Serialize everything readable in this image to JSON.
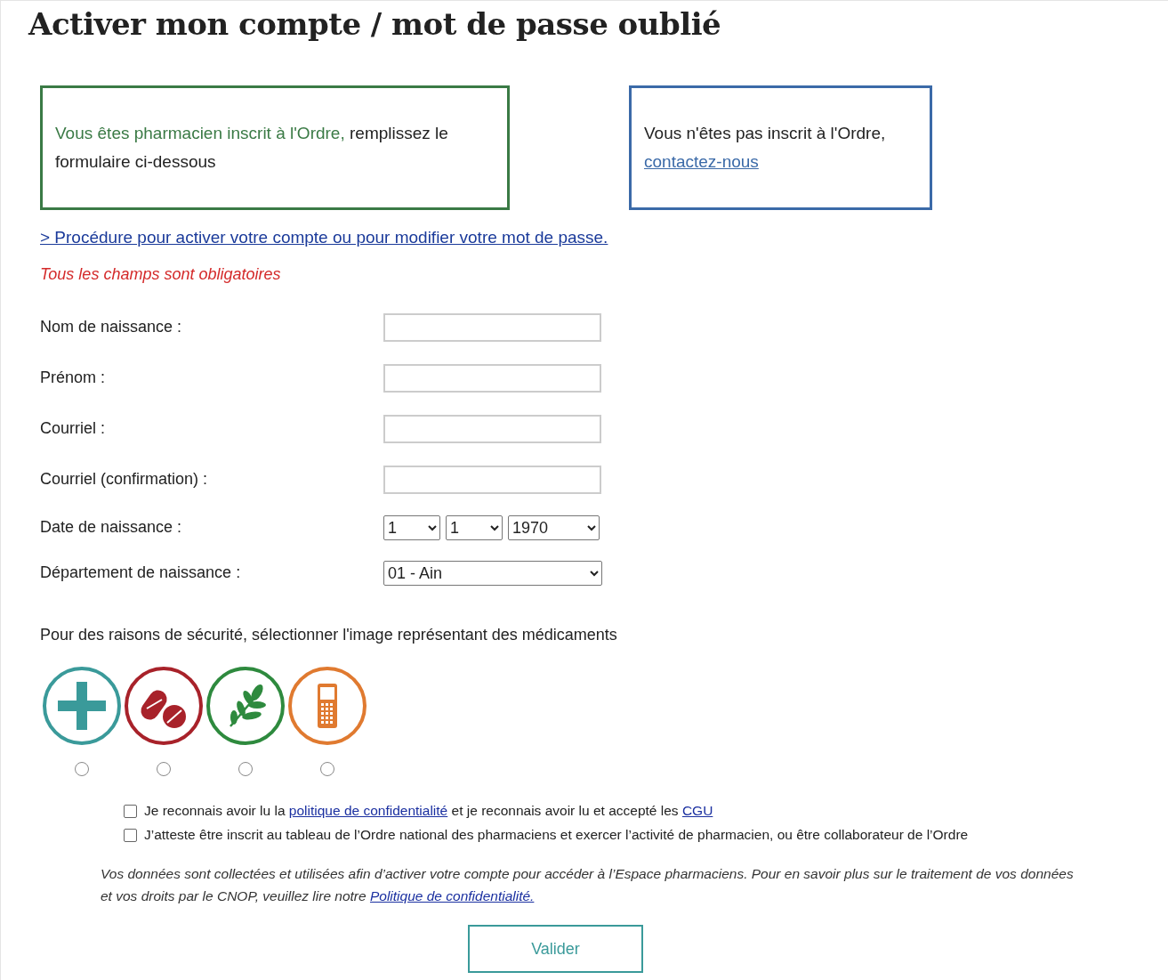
{
  "title": "Activer mon compte / mot de passe oublié",
  "info_boxes": [
    {
      "kind": "member",
      "highlight": "Vous êtes pharmacien inscrit à l'Ordre,",
      "text": " remplissez le formulaire ci-dessous",
      "color": "#3a7a45"
    },
    {
      "kind": "contact",
      "text": "Vous n'êtes pas inscrit à l'Ordre,",
      "link": "contactez-nous",
      "color": "#3b6aa8"
    }
  ],
  "procedure_link": "> Procédure pour activer votre compte ou pour modifier votre mot de passe.",
  "required_note": "Tous les champs sont obligatoires",
  "fields": [
    {
      "kind": "text",
      "label": "Nom de naissance :"
    },
    {
      "kind": "text",
      "label": "Prénom :"
    },
    {
      "kind": "text",
      "label": "Courriel :"
    },
    {
      "kind": "text",
      "label": "Courriel (confirmation) :"
    },
    {
      "kind": "date",
      "label": "Date de naissance :",
      "values": [
        "1",
        "1",
        "1970"
      ]
    },
    {
      "kind": "select",
      "label": "Département de naissance :",
      "value": "01 - Ain"
    }
  ],
  "security_prompt": "Pour des raisons de sécurité, sélectionner l'image représentant des médicaments",
  "security_images": [
    {
      "kind": "cross",
      "color": "#3a9a9a",
      "selected": false
    },
    {
      "kind": "pills",
      "color": "#a8222a",
      "selected": false
    },
    {
      "kind": "leaf",
      "color": "#2e8a3e",
      "selected": false
    },
    {
      "kind": "phone",
      "color": "#e07a30",
      "selected": false
    }
  ],
  "consents": [
    {
      "checked": false,
      "parts": [
        {
          "kind": "text",
          "text": "Je reconnais avoir lu la "
        },
        {
          "kind": "link",
          "text": "politique de confidentialité"
        },
        {
          "kind": "text",
          "text": " et je reconnais avoir lu et accepté les "
        },
        {
          "kind": "link",
          "text": "CGU"
        }
      ]
    },
    {
      "checked": false,
      "parts": [
        {
          "kind": "text",
          "text": "J’atteste être inscrit au tableau de l’Ordre national des pharmaciens et exercer l’activité de pharmacien, ou être collaborateur de l’Ordre"
        }
      ]
    }
  ],
  "privacy_note": {
    "text": "Vos données sont collectées et utilisées afin d’activer votre compte pour accéder à l’Espace pharmaciens. Pour en savoir plus sur le traitement de vos données et vos droits par le CNOP, veuillez lire notre ",
    "link": "Politique de confidentialité."
  },
  "submit_button": "Valider"
}
